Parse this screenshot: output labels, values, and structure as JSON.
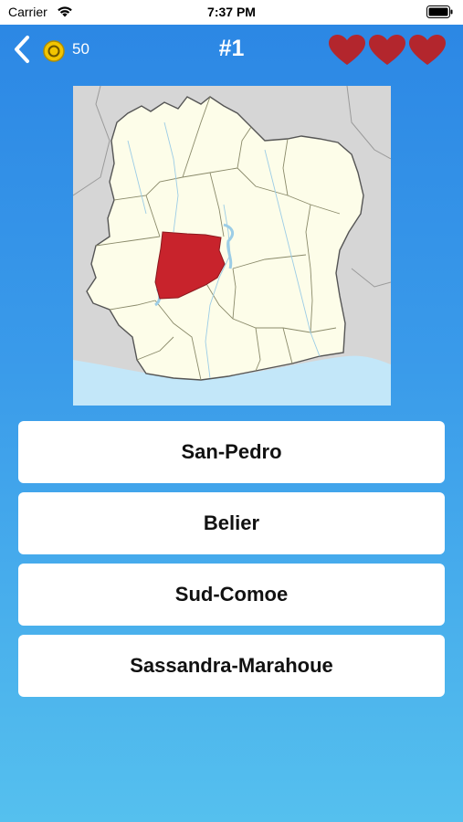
{
  "status_bar": {
    "carrier": "Carrier",
    "time": "7:37 PM",
    "wifi_icon": "wifi-icon",
    "battery_icon": "battery-icon"
  },
  "header": {
    "back_icon": "chevron-left-icon",
    "coin_icon": "coin-icon",
    "coins": "50",
    "question_number": "#1",
    "lives": 3,
    "heart_icon": "heart-icon"
  },
  "map": {
    "highlighted_region_color": "#c8232c",
    "land_color": "#fdfde9",
    "neighbor_color": "#d6d6d6",
    "water_color": "#c3e7f9"
  },
  "answers": [
    {
      "label": "San-Pedro"
    },
    {
      "label": "Belier"
    },
    {
      "label": "Sud-Comoe"
    },
    {
      "label": "Sassandra-Marahoue"
    }
  ],
  "colors": {
    "background_top": "#2b86e4",
    "background_bottom": "#55c0ee",
    "heart": "#b3262d",
    "coin": "#f2c500"
  }
}
